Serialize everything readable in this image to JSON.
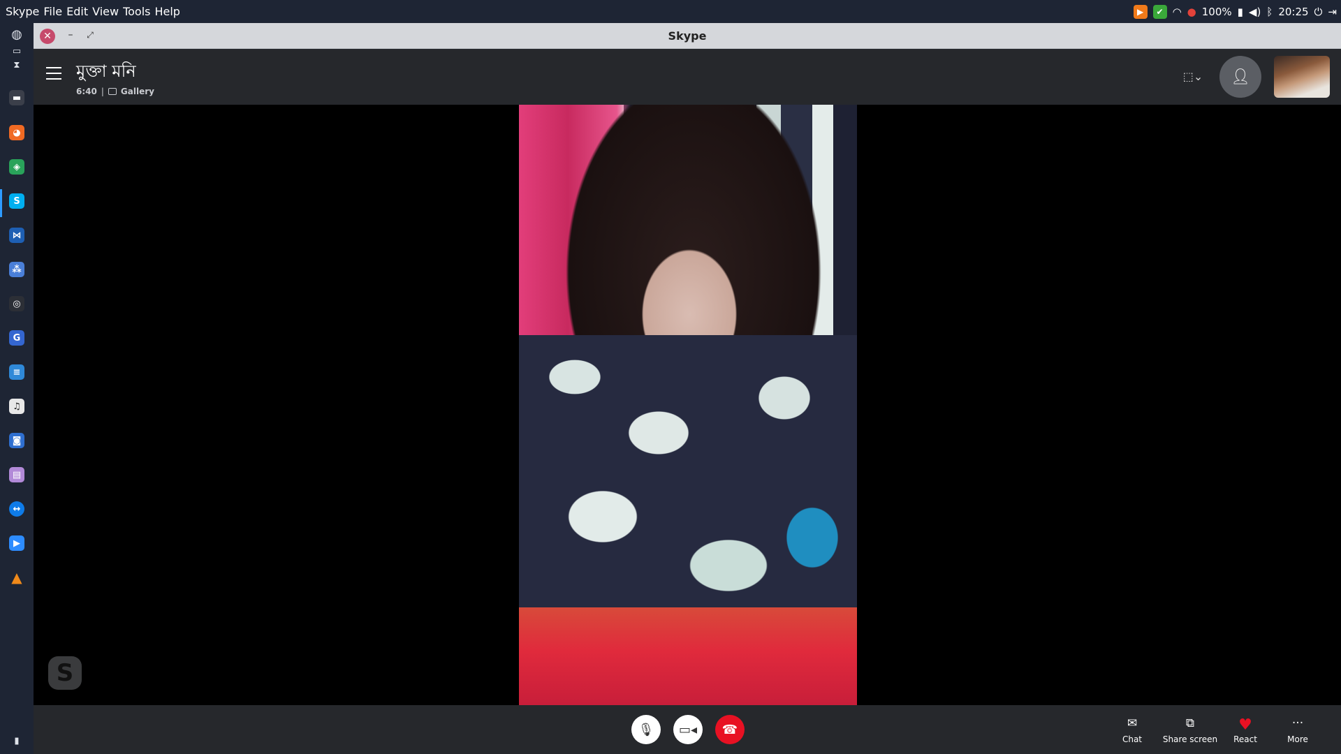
{
  "system_bar": {
    "menus": [
      "Skype",
      "File",
      "Edit",
      "View",
      "Tools",
      "Help"
    ],
    "battery": "100%",
    "clock": "20:25"
  },
  "dock": {
    "items": [
      "globe-icon",
      "folder-icon",
      "hourglass-icon",
      "terminal-app",
      "firefox-app",
      "vpn-app",
      "skype-app",
      "vscode-app",
      "apps-grid",
      "chromium-app",
      "go-app",
      "writer-app",
      "music-app",
      "screenshot-app",
      "files-app",
      "teamviewer-app",
      "zoom-app",
      "vlc-app",
      "trash-icon"
    ]
  },
  "window": {
    "title": "Skype"
  },
  "call": {
    "contact_name": "মুক্তা মনি",
    "duration": "6:40",
    "separator": "|",
    "view_mode": "Gallery"
  },
  "controls": {
    "chat_label": "Chat",
    "share_label": "Share screen",
    "react_label": "React",
    "more_label": "More"
  },
  "colors": {
    "hangup": "#e81123",
    "bar_bg": "#26282c",
    "system_bg": "#1e2534"
  }
}
